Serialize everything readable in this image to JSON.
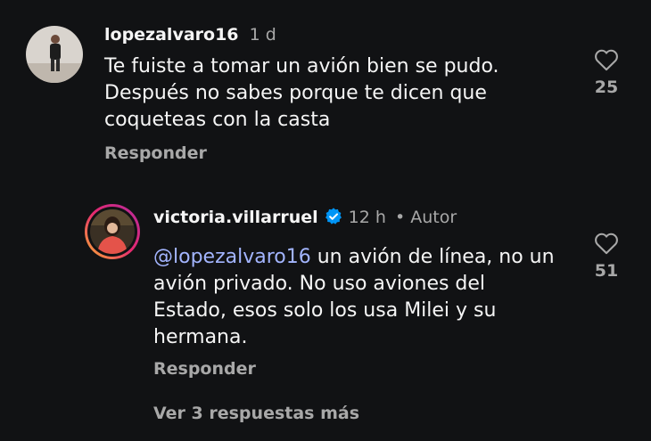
{
  "comments": [
    {
      "username": "lopezalvaro16",
      "time": "1 d",
      "text_lines": [
        "Te fuiste a tomar un avión bien se pudo.",
        "Después no sabes porque te dicen que",
        "coqueteas con la casta"
      ],
      "reply_label": "Responder",
      "like_count": "25",
      "like_icon": "heart-outline-icon"
    },
    {
      "username": "victoria.villarruel",
      "verified": true,
      "time": "12 h",
      "author_badge": "• Autor",
      "mention": "@lopezalvaro16",
      "text_line1_rest": " un avión de línea, no un",
      "text_lines_rest": [
        "avión privado. No uso aviones del",
        "Estado, esos solo los usa Milei y su",
        "hermana."
      ],
      "reply_label": "Responder",
      "like_count": "51",
      "like_icon": "heart-outline-icon"
    }
  ],
  "view_more_label": "Ver 3 respuestas más",
  "colors": {
    "background": "#111214",
    "text": "#f5f5f5",
    "secondary": "#a8a8a8",
    "mention": "#a3b5ff",
    "verified": "#0095f6"
  }
}
